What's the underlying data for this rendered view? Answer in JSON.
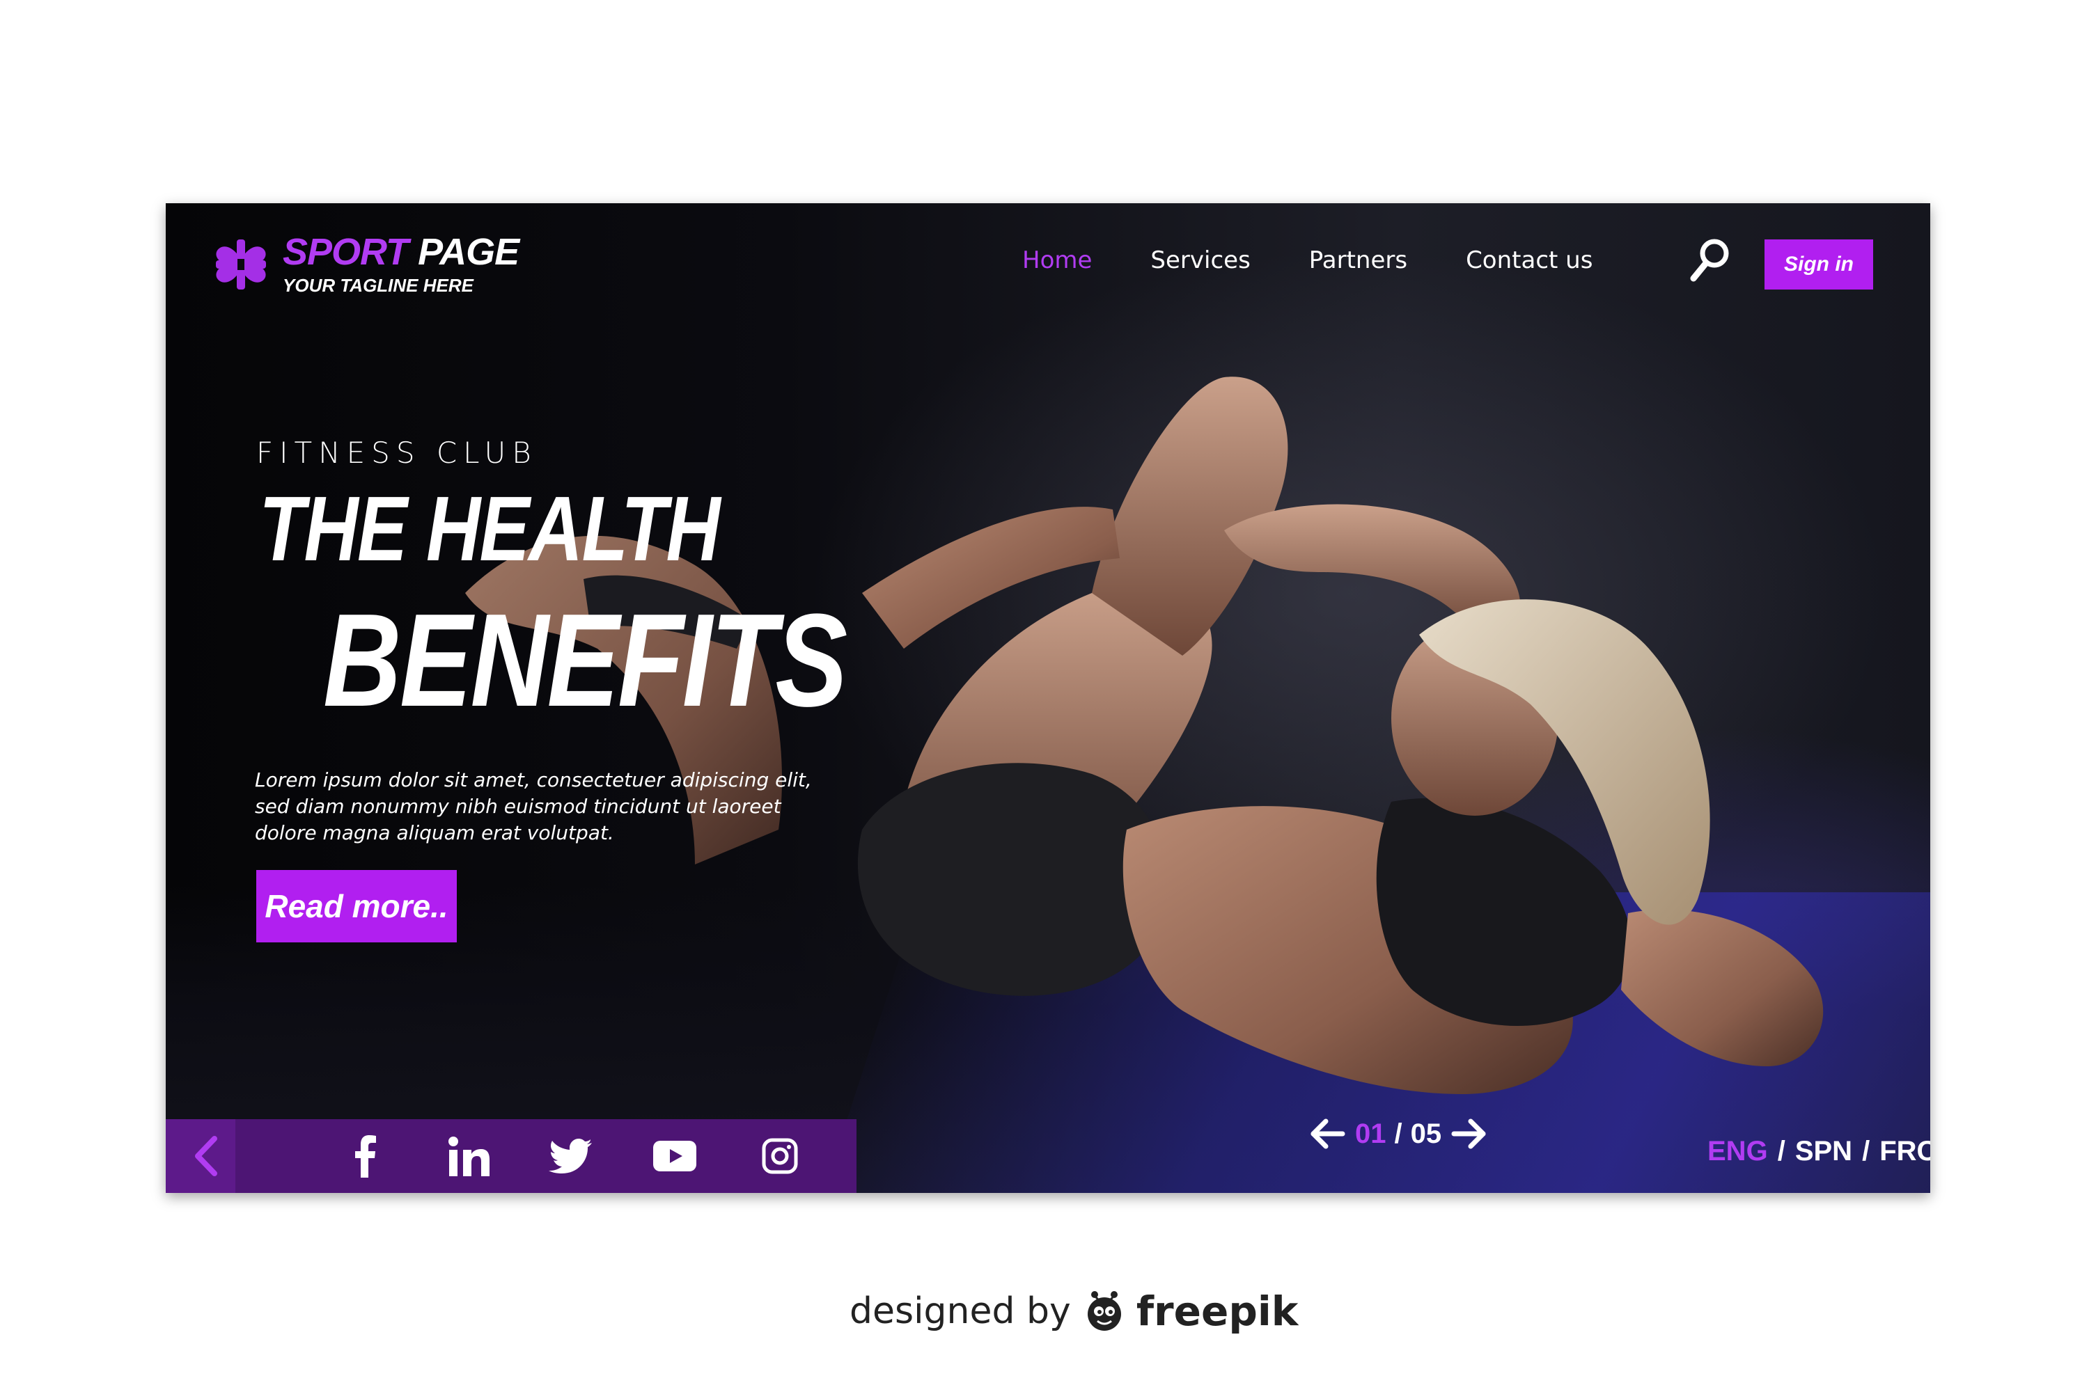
{
  "colors": {
    "accent": "#b11ff0",
    "accent_text": "#b13cf2",
    "bar": "#4d1574",
    "text": "#ffffff"
  },
  "logo": {
    "title_accent": "SPORT",
    "title_rest": "PAGE",
    "tagline": "YOUR TAGLINE HERE",
    "icon": "four-hearts-cross-icon"
  },
  "nav": {
    "items": [
      {
        "label": "Home",
        "active": true
      },
      {
        "label": "Services",
        "active": false
      },
      {
        "label": "Partners",
        "active": false
      },
      {
        "label": "Contact us",
        "active": false
      }
    ],
    "search_icon": "search-icon",
    "signin_label": "Sign in"
  },
  "hero": {
    "eyebrow": "FITNESS CLUB",
    "title_line1": "THE HEALTH",
    "title_line2": "BENEFITS",
    "body": "Lorem ipsum dolor sit amet, consectetuer adipiscing elit, sed diam nonummy nibh euismod tincidunt ut laoreet dolore magna aliquam erat volutpat.",
    "cta_label": "Read more.."
  },
  "social": {
    "back_icon": "chevron-left-icon",
    "icons": [
      "facebook-icon",
      "linkedin-icon",
      "twitter-icon",
      "youtube-icon",
      "instagram-icon"
    ]
  },
  "pager": {
    "current": "01",
    "separator": "/",
    "total": "05",
    "prev_icon": "arrow-left-icon",
    "next_icon": "arrow-right-icon"
  },
  "languages": {
    "items": [
      {
        "label": "ENG",
        "active": true
      },
      {
        "label": "SPN",
        "active": false
      },
      {
        "label": "FRC",
        "active": false
      }
    ],
    "separator": "/"
  },
  "credit": {
    "prefix": "designed by",
    "brand": "freepik",
    "icon": "freepik-mascot-icon"
  }
}
